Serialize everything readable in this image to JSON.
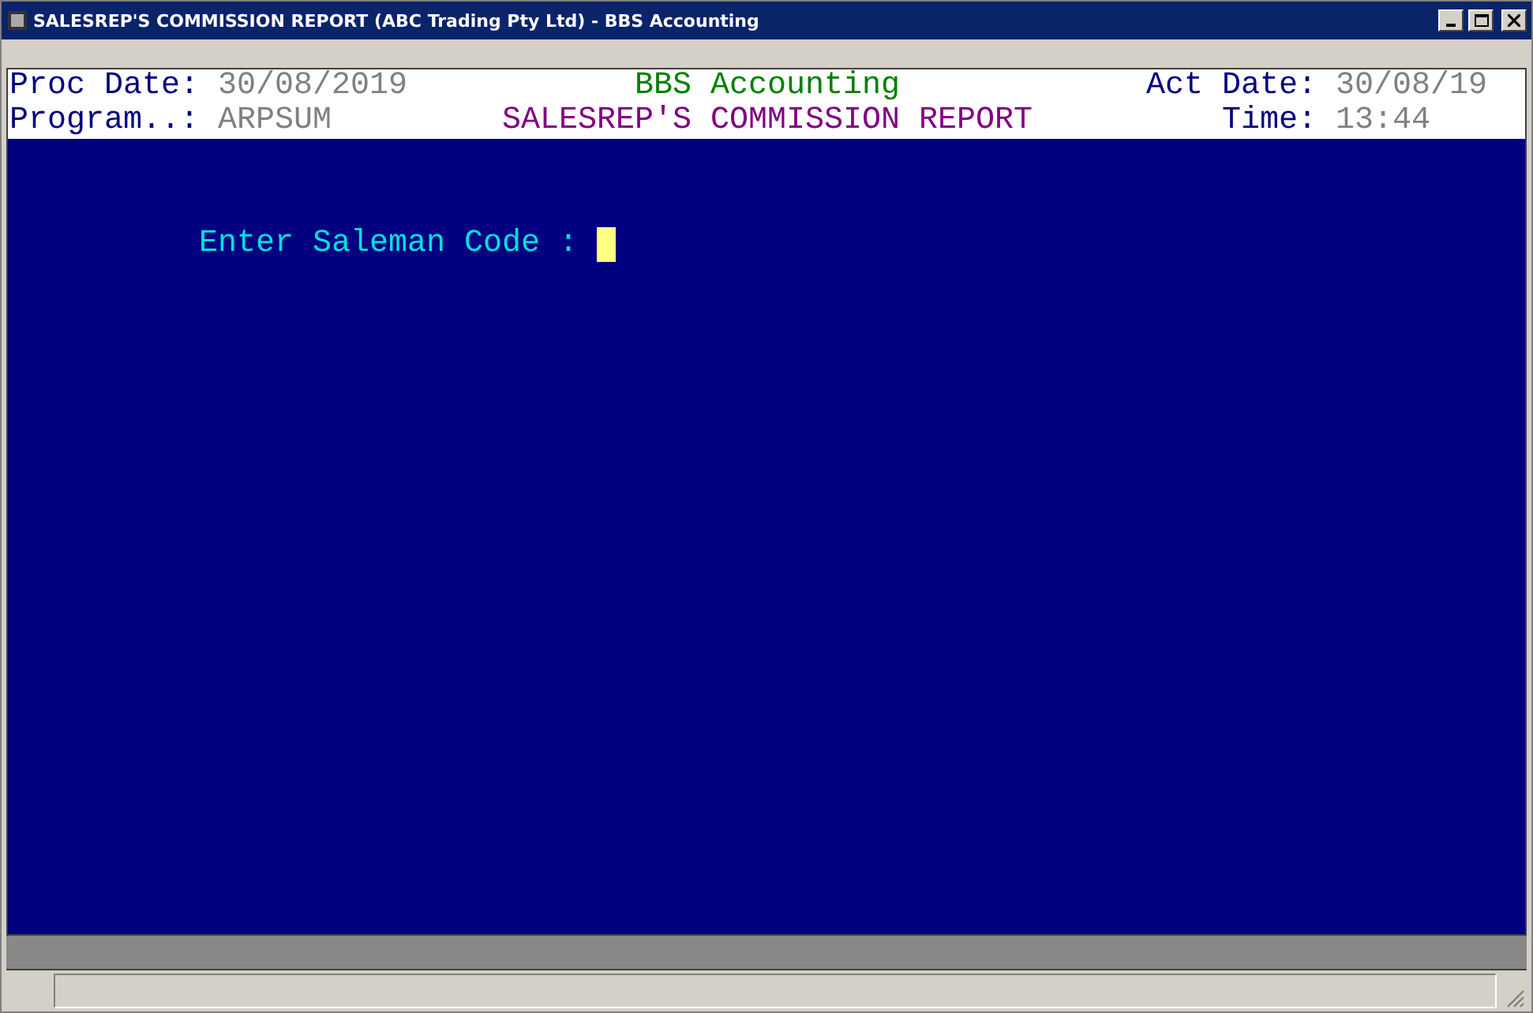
{
  "window": {
    "title": "SALESREP'S COMMISSION REPORT (ABC Trading Pty Ltd) - BBS Accounting"
  },
  "header": {
    "rows": [
      [
        {
          "kind": "label",
          "text": "Proc Date:"
        },
        {
          "kind": "value",
          "text": "30/08/2019"
        },
        {
          "kind": "app",
          "text": "BBS Accounting"
        },
        {
          "kind": "label",
          "text": "Act Date:"
        },
        {
          "kind": "value",
          "text": "30/08/19"
        }
      ],
      [
        {
          "kind": "label",
          "text": "Program..:"
        },
        {
          "kind": "value",
          "text": "ARPSUM"
        },
        {
          "kind": "report",
          "text": "SALESREP'S COMMISSION REPORT"
        },
        {
          "kind": "label",
          "text": "Time:"
        },
        {
          "kind": "value",
          "text": "13:44"
        }
      ]
    ]
  },
  "prompt": {
    "label": "Enter Saleman Code :"
  }
}
